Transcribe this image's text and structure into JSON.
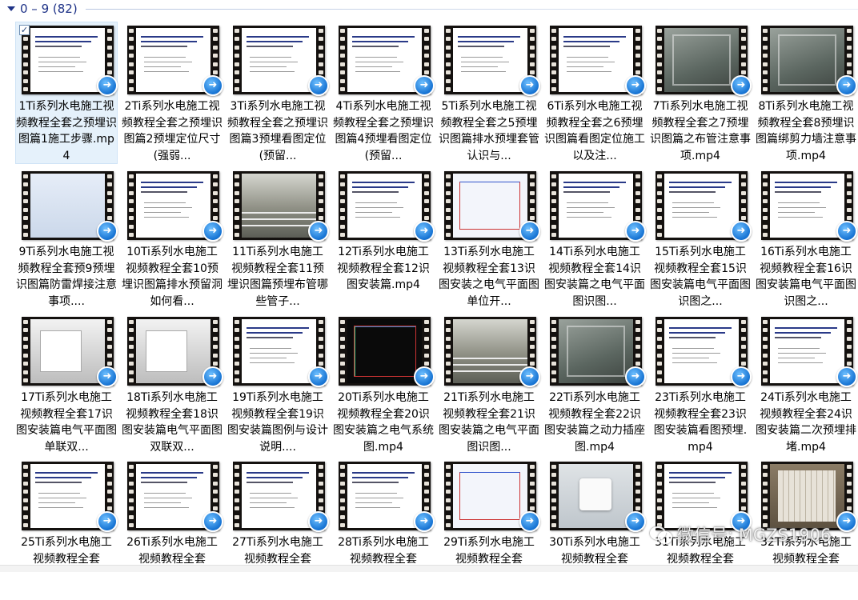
{
  "group": {
    "title": "0 – 9 (82)"
  },
  "files": [
    {
      "name": "1Ti系列水电施工视频教程全套之预埋识图篇1施工步骤.mp4",
      "thumb": "white",
      "selected": true
    },
    {
      "name": "2Ti系列水电施工视频教程全套之预埋识图篇2预埋定位尺寸(强弱...",
      "thumb": "white",
      "selected": false
    },
    {
      "name": "3Ti系列水电施工视频教程全套之预埋识图篇3预埋看图定位 (预留...",
      "thumb": "white",
      "selected": false
    },
    {
      "name": "4Ti系列水电施工视频教程全套之预埋识图篇4预埋看图定位 (预留...",
      "thumb": "white",
      "selected": false
    },
    {
      "name": "5Ti系列水电施工视频教程全套之5预埋识图篇排水预埋套管认识与...",
      "thumb": "white",
      "selected": false
    },
    {
      "name": "6Ti系列水电施工视频教程全套之6预埋识图篇看图定位施工以及注...",
      "thumb": "white",
      "selected": false
    },
    {
      "name": "7Ti系列水电施工视频教程全套之7预埋识图篇之布管注意事项.mp4",
      "thumb": "photo",
      "selected": false
    },
    {
      "name": "8Ti系列水电施工视频教程全套8预埋识图篇绑剪力墙注意事项.mp4",
      "thumb": "photo",
      "selected": false
    },
    {
      "name": "9Ti系列水电施工视频教程全套预9预埋识图篇防雷焊接注意事项....",
      "thumb": "blueish",
      "selected": false
    },
    {
      "name": "10Ti系列水电施工视频教程全套10预埋识图篇排水预留洞如何看...",
      "thumb": "white",
      "selected": false
    },
    {
      "name": "11Ti系列水电施工视频教程全套11预埋识图篇预埋布管哪些管子...",
      "thumb": "site",
      "selected": false
    },
    {
      "name": "12Ti系列水电施工视频教程全套12识图安装篇.mp4",
      "thumb": "white",
      "selected": false
    },
    {
      "name": "13Ti系列水电施工视频教程全套13识图安装之电气平面图单位开...",
      "thumb": "plan",
      "selected": false
    },
    {
      "name": "14Ti系列水电施工视频教程全套14识图安装篇之电气平面图识图...",
      "thumb": "white",
      "selected": false
    },
    {
      "name": "15Ti系列水电施工视频教程全套15识图安装篇电气平面图识图之...",
      "thumb": "white",
      "selected": false
    },
    {
      "name": "16Ti系列水电施工视频教程全套16识图安装篇电气平面图识图之...",
      "thumb": "white",
      "selected": false
    },
    {
      "name": "17Ti系列水电施工视频教程全套17识图安装篇电气平面图单联双...",
      "thumb": "room",
      "selected": false
    },
    {
      "name": "18Ti系列水电施工视频教程全套18识图安装篇电气平面图双联双...",
      "thumb": "room",
      "selected": false
    },
    {
      "name": "19Ti系列水电施工视频教程全套19识图安装篇图例与设计说明....",
      "thumb": "white",
      "selected": false
    },
    {
      "name": "20Ti系列水电施工视频教程全套20识图安装篇之电气系统图.mp4",
      "thumb": "cad",
      "selected": false
    },
    {
      "name": "21Ti系列水电施工视频教程全套21识图安装篇之电气平面图识图...",
      "thumb": "site",
      "selected": false
    },
    {
      "name": "22Ti系列水电施工视频教程全套22识图安装篇之动力插座图.mp4",
      "thumb": "photo",
      "selected": false
    },
    {
      "name": "23Ti系列水电施工视频教程全套23识图安装篇看图预埋.mp4",
      "thumb": "white",
      "selected": false
    },
    {
      "name": "24Ti系列水电施工视频教程全套24识图安装篇二次预埋排堵.mp4",
      "thumb": "white",
      "selected": false
    },
    {
      "name": "25Ti系列水电施工视频教程全套",
      "thumb": "white",
      "selected": false
    },
    {
      "name": "26Ti系列水电施工视频教程全套",
      "thumb": "white",
      "selected": false
    },
    {
      "name": "27Ti系列水电施工视频教程全套",
      "thumb": "white",
      "selected": false
    },
    {
      "name": "28Ti系列水电施工视频教程全套",
      "thumb": "white",
      "selected": false
    },
    {
      "name": "29Ti系列水电施工视频教程全套",
      "thumb": "plan",
      "selected": false
    },
    {
      "name": "30Ti系列水电施工视频教程全套",
      "thumb": "socket",
      "selected": false
    },
    {
      "name": "31Ti系列水电施工视频教程全套",
      "thumb": "white",
      "selected": false
    },
    {
      "name": "32Ti系列水电施工视频教程全套",
      "thumb": "panel",
      "selected": false
    }
  ],
  "watermark": {
    "text": "微信号: MGZS1906"
  },
  "icons": {
    "group_collapse": "chevron-down-icon",
    "play_badge": "play-overlay-icon",
    "checkbox": "checkmark-icon"
  },
  "colors": {
    "group_title": "#1e3287",
    "selection_bg": "#e5f1fb",
    "play_badge": "#1673d3"
  }
}
